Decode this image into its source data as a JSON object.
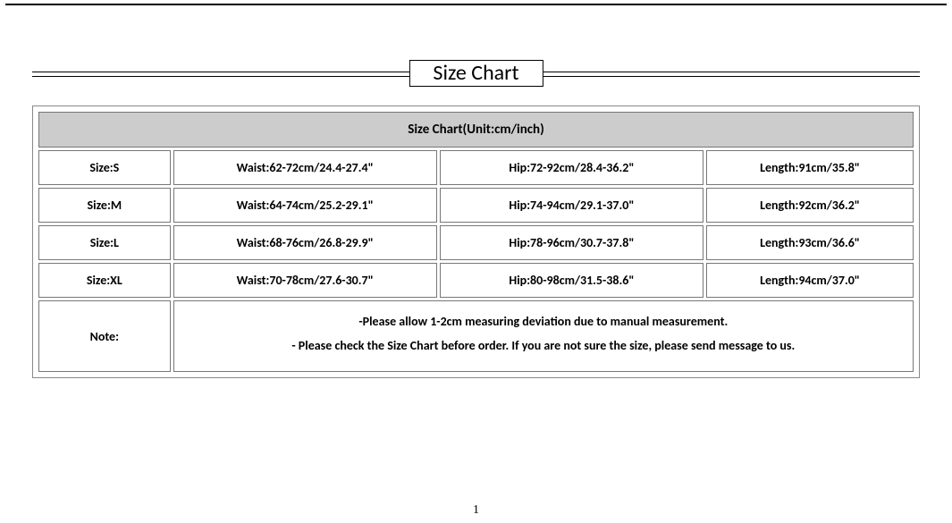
{
  "title": "Size Chart",
  "table_header": "Size Chart(Unit:cm/inch)",
  "rows": [
    {
      "size": "Size:S",
      "waist": "Waist:62-72cm/24.4-27.4\"",
      "hip": "Hip:72-92cm/28.4-36.2\"",
      "length": "Length:91cm/35.8\""
    },
    {
      "size": "Size:M",
      "waist": "Waist:64-74cm/25.2-29.1\"",
      "hip": "Hip:74-94cm/29.1-37.0\"",
      "length": "Length:92cm/36.2\""
    },
    {
      "size": "Size:L",
      "waist": "Waist:68-76cm/26.8-29.9\"",
      "hip": "Hip:78-96cm/30.7-37.8\"",
      "length": "Length:93cm/36.6\""
    },
    {
      "size": "Size:XL",
      "waist": "Waist:70-78cm/27.6-30.7\"",
      "hip": "Hip:80-98cm/31.5-38.6\"",
      "length": "Length:94cm/37.0\""
    }
  ],
  "note_label": "Note:",
  "note_lines": [
    "-Please allow 1-2cm measuring deviation due to manual measurement.",
    "- Please check the Size Chart before order. If you are not sure the size, please send message to us."
  ],
  "page_number": "1"
}
